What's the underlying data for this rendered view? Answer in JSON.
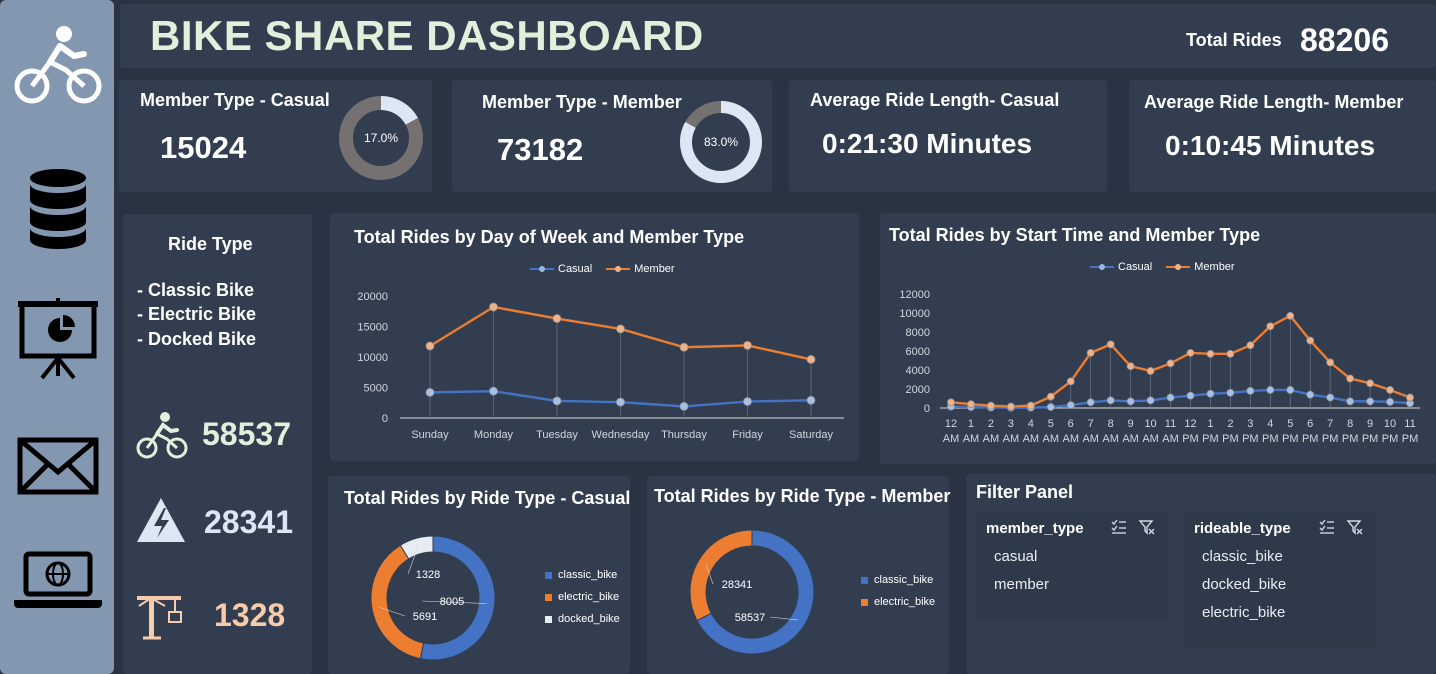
{
  "header": {
    "title": "BIKE SHARE DASHBOARD",
    "total_label": "Total Rides",
    "total_value": "88206"
  },
  "sidebar": {
    "icons": [
      "cyclist-icon",
      "database-icon",
      "presentation-icon",
      "mail-icon",
      "laptop-globe-icon"
    ]
  },
  "kpis": {
    "casual": {
      "title": "Member Type - Casual",
      "value": "15024",
      "pct": "17.0%",
      "fraction": 0.17
    },
    "member": {
      "title": "Member Type - Member",
      "value": "73182",
      "pct": "83.0%",
      "fraction": 0.83
    },
    "avg_casual": {
      "title": "Average Ride Length- Casual",
      "value": "0:21:30 Minutes"
    },
    "avg_member": {
      "title": "Average Ride Length- Member",
      "value": "0:10:45 Minutes"
    }
  },
  "ride_type": {
    "title": "Ride Type",
    "items": [
      "- Classic Bike",
      "- Electric Bike",
      "- Docked Bike"
    ],
    "classic_count": "58537",
    "electric_count": "28341",
    "docked_count": "1328"
  },
  "colors": {
    "casual": "#4472c4",
    "member": "#ed7d31",
    "docked": "#e7ecf2",
    "donut_casual": "#757171",
    "donut_member": "#dde7f3",
    "bg": "#2a3341",
    "panel": "#323e4f"
  },
  "chart_data": [
    {
      "type": "line",
      "title": "Total Rides by Day of Week and Member Type",
      "categories": [
        "Sunday",
        "Monday",
        "Tuesday",
        "Wednesday",
        "Thursday",
        "Friday",
        "Saturday"
      ],
      "series": [
        {
          "name": "Casual",
          "values": [
            4200,
            4400,
            2800,
            2600,
            1900,
            2700,
            2900
          ]
        },
        {
          "name": "Member",
          "values": [
            11800,
            18200,
            16300,
            14600,
            11600,
            11900,
            9600
          ]
        }
      ],
      "yticks": [
        0,
        5000,
        10000,
        15000,
        20000
      ],
      "ylim": [
        0,
        20000
      ]
    },
    {
      "type": "line",
      "title": "Total Rides by Start Time and Member Type",
      "categories": [
        "12 AM",
        "1 AM",
        "2 AM",
        "3 AM",
        "4 AM",
        "5 AM",
        "6 AM",
        "7 AM",
        "8 AM",
        "9 AM",
        "10 AM",
        "11 AM",
        "12 PM",
        "1 PM",
        "2 PM",
        "3 PM",
        "4 PM",
        "5 PM",
        "6 PM",
        "7 PM",
        "8 PM",
        "9 PM",
        "10 PM",
        "11 PM"
      ],
      "series": [
        {
          "name": "Casual",
          "values": [
            150,
            100,
            60,
            40,
            40,
            100,
            300,
            600,
            800,
            700,
            800,
            1100,
            1300,
            1500,
            1600,
            1800,
            1900,
            1900,
            1400,
            1100,
            700,
            700,
            650,
            500
          ]
        },
        {
          "name": "Member",
          "values": [
            600,
            400,
            250,
            150,
            250,
            1200,
            2800,
            5800,
            6700,
            4400,
            3900,
            4700,
            5800,
            5700,
            5700,
            6600,
            8600,
            9700,
            7100,
            4800,
            3100,
            2600,
            1900,
            1100
          ]
        }
      ],
      "yticks": [
        0,
        2000,
        4000,
        6000,
        8000,
        10000,
        12000
      ],
      "ylim": [
        0,
        12000
      ]
    },
    {
      "type": "pie",
      "title": "Total Rides by Ride Type - Casual",
      "categories": [
        "classic_bike",
        "electric_bike",
        "docked_bike"
      ],
      "values": [
        8005,
        5691,
        1328
      ]
    },
    {
      "type": "pie",
      "title": "Total Rides by Ride Type - Member",
      "categories": [
        "classic_bike",
        "electric_bike"
      ],
      "values": [
        58537,
        28341
      ]
    }
  ],
  "filter_panel": {
    "title": "Filter Panel",
    "member_type": {
      "field": "member_type",
      "options": [
        "casual",
        "member"
      ]
    },
    "rideable_type": {
      "field": "rideable_type",
      "options": [
        "classic_bike",
        "docked_bike",
        "electric_bike"
      ]
    }
  }
}
